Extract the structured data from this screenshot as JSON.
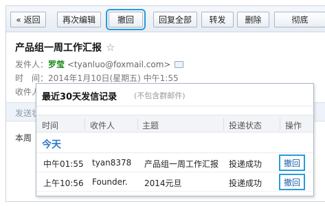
{
  "toolbar": {
    "back": "« 返回",
    "reedit": "再次编辑",
    "recall": "撤回",
    "reply_all": "回复全部",
    "forward": "转发",
    "delete": "删除",
    "purge": "彻底"
  },
  "email": {
    "subject": "产品组一周工作汇报",
    "star": "☆",
    "from_label": "发件人：",
    "sender": "罗莹",
    "address": "<tyanluo@foxmail.com>",
    "time_label": "时　间：",
    "time": "2014年1月10日(星期五) 中午1:55",
    "to_label": "收件人",
    "strip_text": "发送状",
    "body_start": "本周"
  },
  "popup": {
    "title": "最近30天发信记录",
    "note": "(不包含群邮件)",
    "columns": [
      "时间",
      "收件人",
      "主题",
      "投递状态",
      "操作"
    ],
    "group_today": "今天",
    "rows": [
      {
        "time": "中午01:55",
        "recipient": "tyan8378",
        "subject": "产品组一周工作汇报",
        "status": "投递成功",
        "action": "撤回"
      },
      {
        "time": "上午10:56",
        "recipient": "Founder.",
        "subject": "2014元旦",
        "status": "投递成功",
        "action": "撤回"
      }
    ]
  },
  "colors": {
    "accent_blue": "#2a9ad8",
    "sender_green": "#1c8a1c",
    "group_blue": "#2a79c7"
  }
}
